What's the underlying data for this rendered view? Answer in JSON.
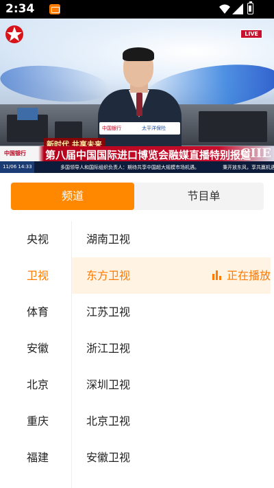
{
  "status_bar": {
    "time": "2:34"
  },
  "player": {
    "live_badge": "LIVE",
    "sponsor_left": "中国银行",
    "sponsor_right": "太平洋保险",
    "slogan": "新时代 共享未来",
    "headline_bank": "中国银行",
    "headline": "第八届中国国际进口博览会融媒直播特别报道",
    "headline_logo": "CIIE",
    "ticker_clock": "11/06 14:33",
    "ticker_text": "多国领导人和国际组织负责人：期待共享中国超大规模市场机遇。",
    "ticker_text_2": "秉开放东风，享共赢机遇"
  },
  "tabs": {
    "channels_label": "频道",
    "schedule_label": "节目单"
  },
  "categories": [
    {
      "label": "央视"
    },
    {
      "label": "卫视"
    },
    {
      "label": "体育"
    },
    {
      "label": "安徽"
    },
    {
      "label": "北京"
    },
    {
      "label": "重庆"
    },
    {
      "label": "福建"
    }
  ],
  "active_category_index": 1,
  "channels": [
    {
      "label": "湖南卫视"
    },
    {
      "label": "东方卫视"
    },
    {
      "label": "江苏卫视"
    },
    {
      "label": "浙江卫视"
    },
    {
      "label": "深圳卫视"
    },
    {
      "label": "北京卫视"
    },
    {
      "label": "安徽卫视"
    }
  ],
  "active_channel_index": 1,
  "now_playing_label": "正在播放",
  "colors": {
    "accent": "#ff8800",
    "active_row_bg": "#fff3e4"
  }
}
